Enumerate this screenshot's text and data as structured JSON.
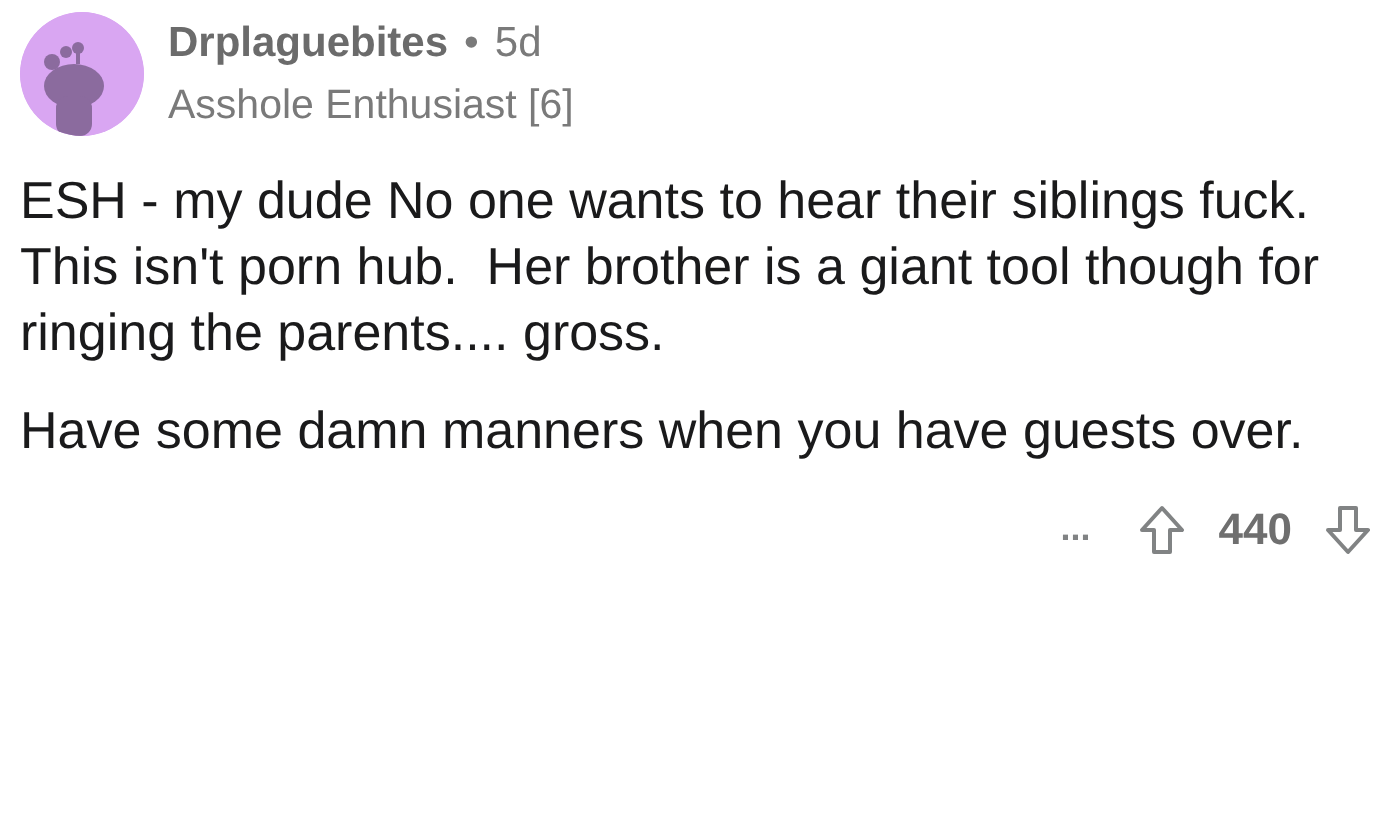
{
  "comment": {
    "author": "Drplaguebites",
    "separator": "•",
    "age": "5d",
    "flair": "Asshole Enthusiast [6]",
    "paragraphs": [
      "ESH - my dude No one wants to hear their siblings fuck.  This isn't porn hub.  Her brother is a giant tool though for ringing the parents.... gross.",
      "Have some damn manners when you have guests over."
    ],
    "more": "...",
    "score": "440"
  }
}
